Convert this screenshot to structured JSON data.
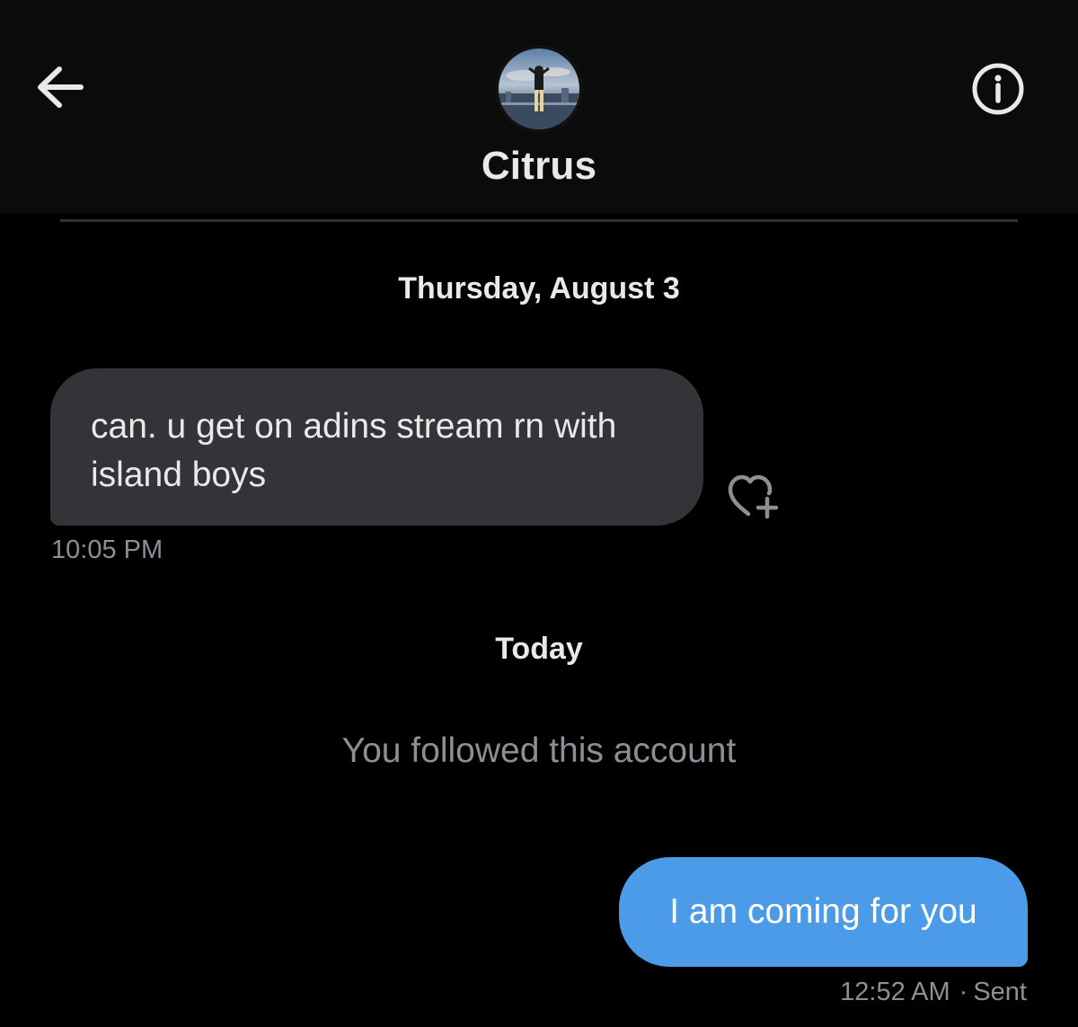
{
  "header": {
    "contact_name": "Citrus",
    "back_icon": "arrow-left-icon",
    "info_icon": "info-icon"
  },
  "conversation": {
    "date_separators": [
      "Thursday, August 3",
      "Today"
    ],
    "incoming_message": {
      "text": "can. u get on adins stream rn with island boys",
      "time": "10:05 PM"
    },
    "react_icon": "heart-plus-icon",
    "system_note": "You followed this account",
    "outgoing_message": {
      "text": "I am coming for you",
      "time": "12:52 AM",
      "separator": "·",
      "status": "Sent"
    }
  },
  "colors": {
    "background": "#000000",
    "incoming_bubble": "#333437",
    "outgoing_bubble": "#4c9be8",
    "secondary_text": "#8b9096",
    "primary_text": "#e7e9ea"
  }
}
